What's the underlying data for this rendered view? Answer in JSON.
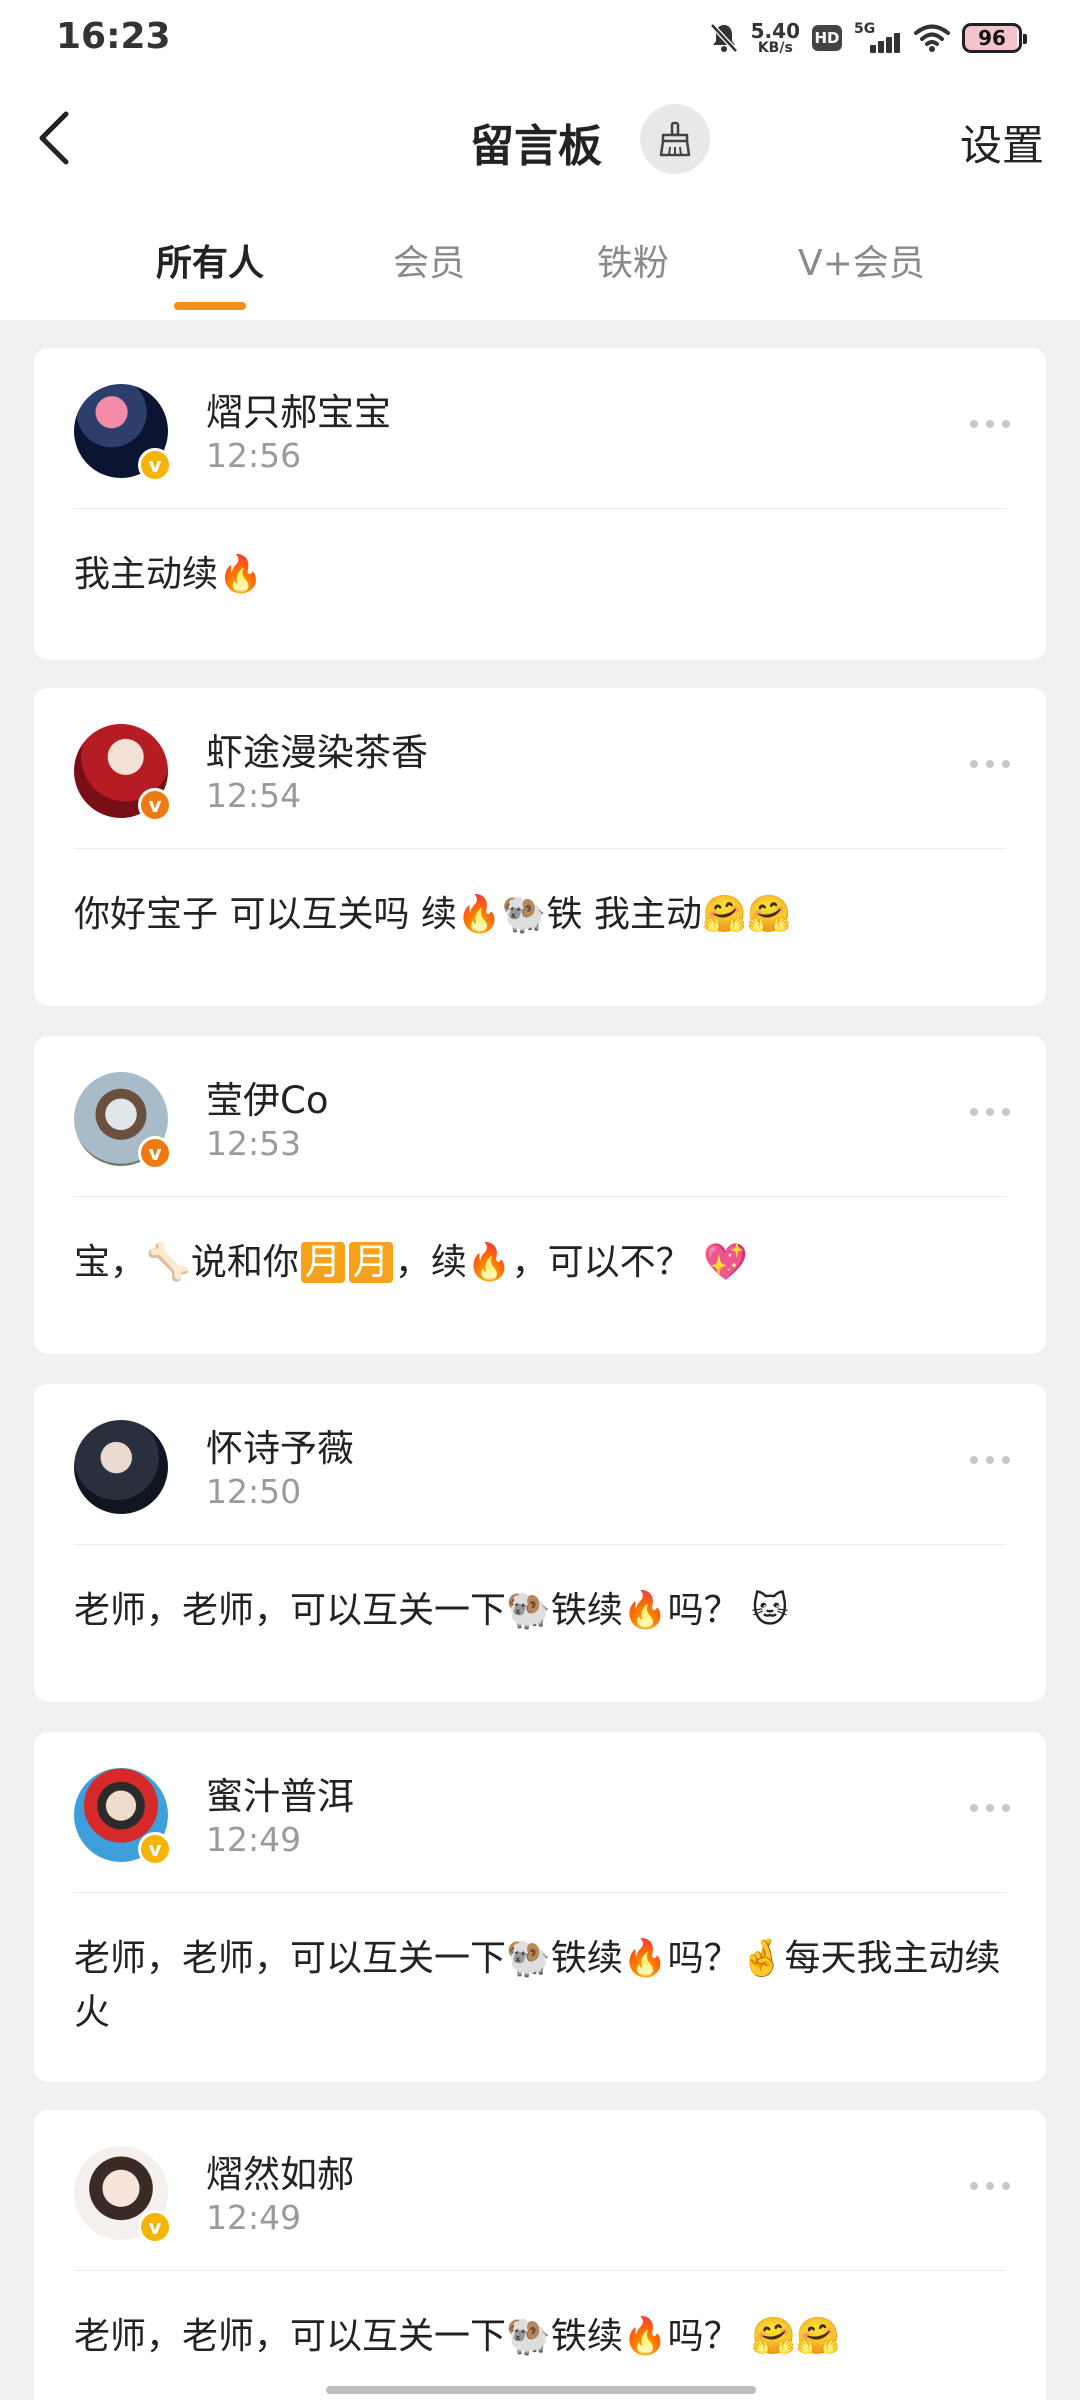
{
  "status_bar": {
    "time": "16:23",
    "net_speed_value": "5.40",
    "net_speed_unit": "KB/s",
    "hd": "HD",
    "network": "5G",
    "battery": "96"
  },
  "header": {
    "title": "留言板",
    "settings_label": "设置"
  },
  "tabs": [
    {
      "label": "所有人",
      "active": true
    },
    {
      "label": "会员",
      "active": false
    },
    {
      "label": "铁粉",
      "active": false
    },
    {
      "label": "V+会员",
      "active": false
    }
  ],
  "comments": [
    {
      "name": "熠只郝宝宝",
      "time": "12:56",
      "text": "我主动续🔥",
      "badge_color": "#f5b400"
    },
    {
      "name": "虾途漫染茶香",
      "time": "12:54",
      "text": "你好宝子 可以互关吗 续🔥🐏铁 我主动🤗🤗",
      "badge_color": "#f07a12"
    },
    {
      "name": "莹伊Co",
      "time": "12:53",
      "text_parts": [
        "宝，🦴说和你",
        "月",
        "月",
        "，续🔥，可以不？ 💖"
      ],
      "badge_color": "#f07a12"
    },
    {
      "name": "怀诗予薇",
      "time": "12:50",
      "text": "老师，老师，可以互关一下🐏铁续🔥吗？ 🐱"
    },
    {
      "name": "蜜汁普洱",
      "time": "12:49",
      "text": "老师，老师，可以互关一下🐏铁续🔥吗？🤞每天我主动续火",
      "badge_color": "#f5b400"
    },
    {
      "name": "熠然如郝",
      "time": "12:49",
      "text": "老师，老师，可以互关一下🐏铁续🔥吗？ 🤗🤗",
      "badge_color": "#f5b400"
    }
  ]
}
